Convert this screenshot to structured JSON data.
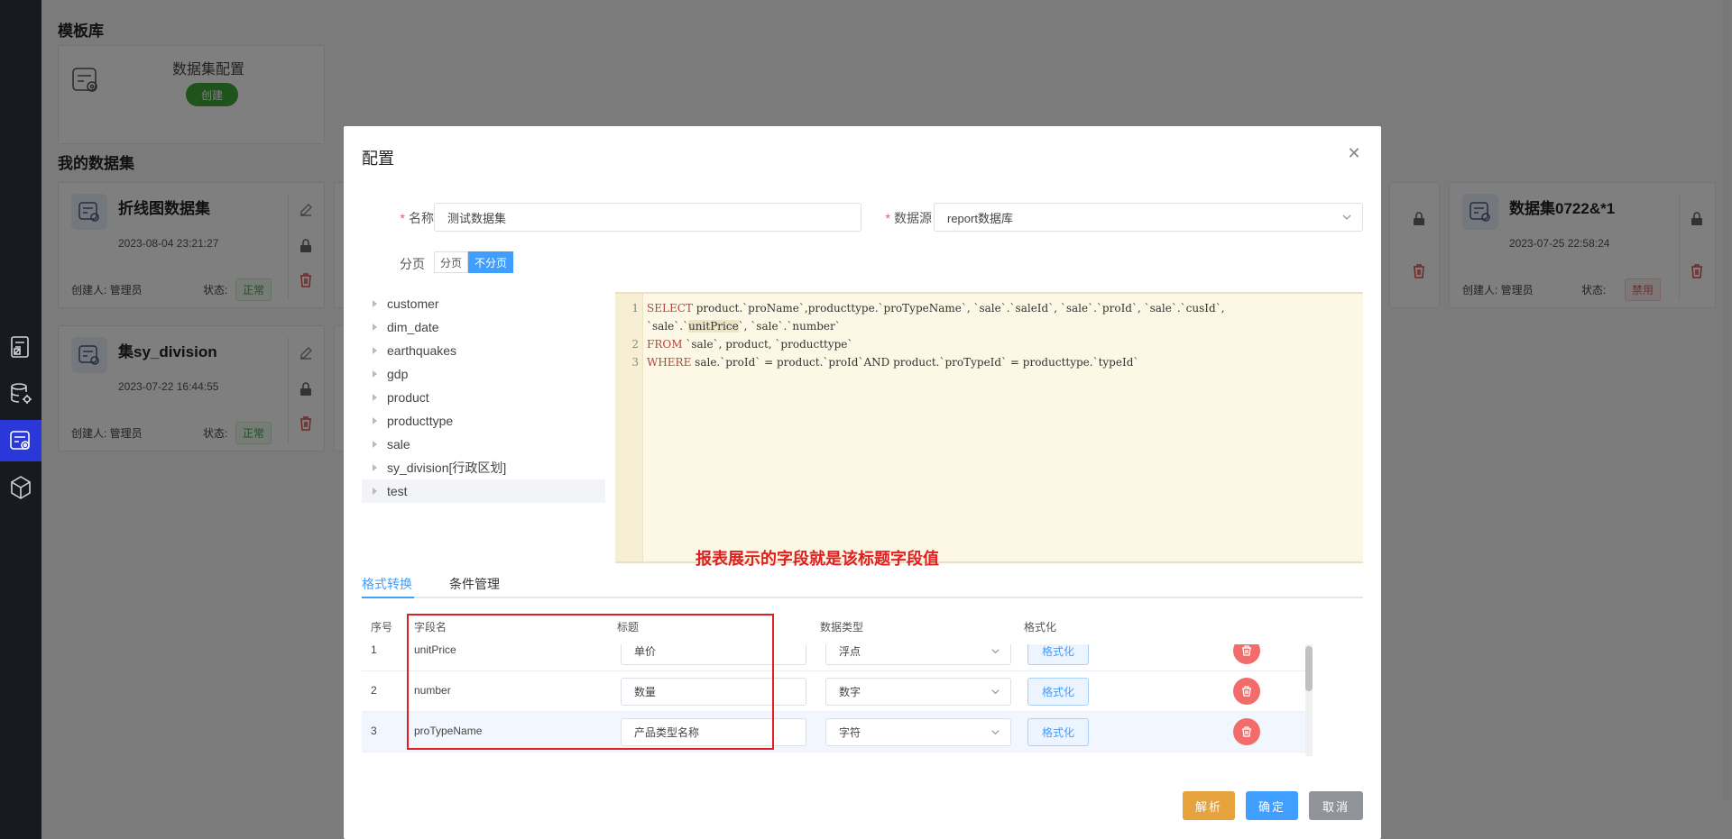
{
  "sidebar": {
    "items": [
      {
        "icon": "report-icon"
      },
      {
        "icon": "database-settings-icon"
      },
      {
        "icon": "dataset-icon",
        "active": true
      },
      {
        "icon": "cube-icon"
      }
    ]
  },
  "page": {
    "template_section_title": "模板库",
    "template_card": {
      "name": "数据集配置",
      "create_label": "创建"
    },
    "my_section_title": "我的数据集",
    "datasets": [
      {
        "name": "折线图数据集",
        "time": "2023-08-04 23:21:27",
        "creator": "创建人: 管理员",
        "status_label": "状态:",
        "status": "正常"
      },
      {
        "name": "集sy_division",
        "time": "2023-07-22 16:44:55",
        "creator": "创建人: 管理员",
        "status_label": "状态:",
        "status": "正常"
      },
      {
        "name": "数据集0722&*1",
        "time": "2023-07-25 22:58:24",
        "creator": "创建人: 管理员",
        "status_label": "状态:",
        "status": "禁用"
      }
    ]
  },
  "dialog": {
    "title": "配置",
    "name_label": "名称",
    "name_value": "测试数据集",
    "source_label": "数据源",
    "source_value": "report数据库",
    "paging_label": "分页",
    "paging_options": [
      "分页",
      "不分页"
    ],
    "paging_selected": "不分页",
    "tables": [
      "customer",
      "dim_date",
      "earthquakes",
      "gdp",
      "product",
      "producttype",
      "sale",
      "sy_division[行政区划]",
      "test"
    ],
    "annotation": "报表展示的字段就是该标题字段值",
    "tabs": [
      "格式转换",
      "条件管理"
    ],
    "table_headers": {
      "index": "序号",
      "field": "字段名",
      "title": "标题",
      "type": "数据类型",
      "format": "格式化"
    },
    "rows": [
      {
        "index": "1",
        "field": "unitPrice",
        "title": "单价",
        "type": "浮点",
        "format_label": "格式化"
      },
      {
        "index": "2",
        "field": "number",
        "title": "数量",
        "type": "数字",
        "format_label": "格式化"
      },
      {
        "index": "3",
        "field": "proTypeName",
        "title": "产品类型名称",
        "type": "字符",
        "format_label": "格式化"
      }
    ],
    "buttons": {
      "parse": "解析",
      "confirm": "确定",
      "cancel": "取消"
    }
  },
  "colors": {
    "primary": "#409eff",
    "warning": "#e6a23c",
    "danger": "#f36c6c",
    "success": "#3ea638",
    "annotation": "#e02020"
  }
}
